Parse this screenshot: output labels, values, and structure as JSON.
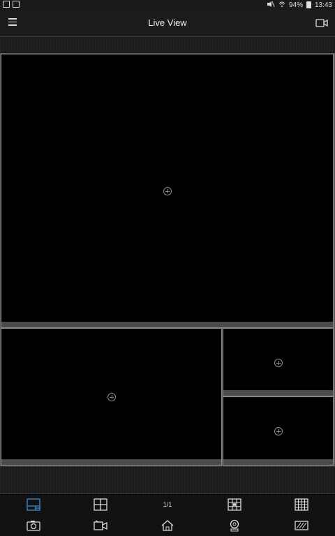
{
  "status_bar": {
    "battery_percent": "94%",
    "time": "13:43",
    "icons": [
      "app-notification-icon",
      "image-notification-icon",
      "mute-icon",
      "wifi-icon",
      "battery-icon"
    ]
  },
  "app_bar": {
    "title": "Live View",
    "left_icon": "menu-icon",
    "right_icon": "video-record-icon"
  },
  "view_panes": [
    {
      "name": "pane-1",
      "icon": "add-channel-icon"
    },
    {
      "name": "pane-2",
      "icon": "add-channel-icon"
    },
    {
      "name": "pane-3",
      "icon": "add-channel-icon"
    },
    {
      "name": "pane-4",
      "icon": "add-channel-icon"
    }
  ],
  "layout_toolbar": {
    "page_indicator": "1/1",
    "items": [
      {
        "icon": "layout-1plus3-icon",
        "selected": true
      },
      {
        "icon": "layout-4-grid-icon"
      },
      {
        "icon": "layout-9-grid-icon"
      },
      {
        "icon": "layout-16-grid-icon"
      }
    ]
  },
  "action_toolbar": {
    "items": [
      {
        "icon": "camera-snapshot-icon"
      },
      {
        "icon": "video-record-icon"
      },
      {
        "icon": "home-icon"
      },
      {
        "icon": "ptz-control-icon"
      },
      {
        "icon": "image-quality-icon"
      }
    ]
  },
  "colors": {
    "accent": "#3a8fd6",
    "background": "#1b1b1b",
    "pane_background": "#000000",
    "pane_border": "#8a8a8a"
  }
}
